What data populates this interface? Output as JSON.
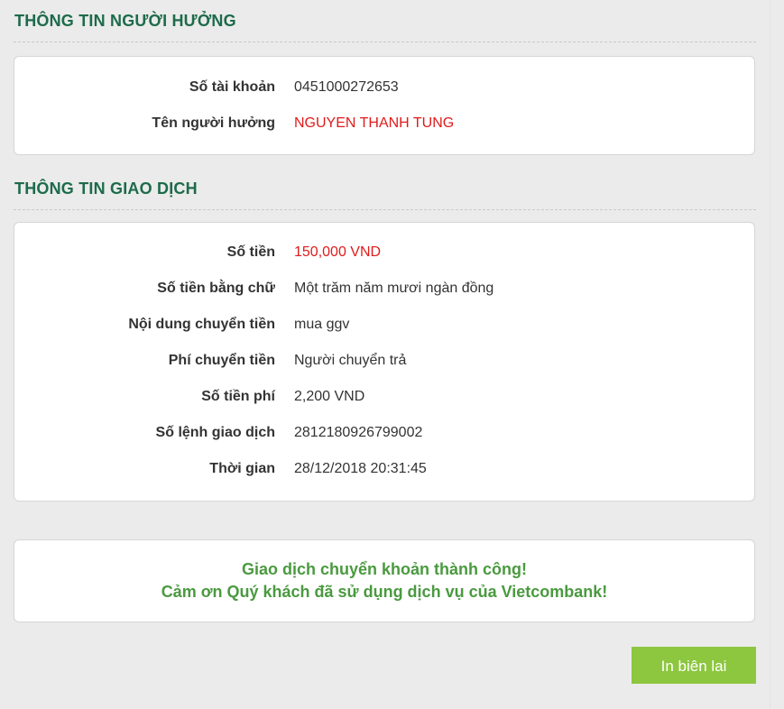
{
  "beneficiary": {
    "title": "THÔNG TIN NGƯỜI HƯỞNG",
    "rows": [
      {
        "label": "Số tài khoản",
        "value": "0451000272653"
      },
      {
        "label": "Tên người hưởng",
        "value": "NGUYEN THANH TUNG"
      }
    ]
  },
  "transaction": {
    "title": "THÔNG TIN GIAO DỊCH",
    "rows": [
      {
        "label": "Số tiền",
        "value": "150,000 VND"
      },
      {
        "label": "Số tiền bằng chữ",
        "value": "Một trăm năm mươi ngàn đồng"
      },
      {
        "label": "Nội dung chuyển tiền",
        "value": "mua ggv"
      },
      {
        "label": "Phí chuyển tiền",
        "value": "Người chuyển trả"
      },
      {
        "label": "Số tiền phí",
        "value": "2,200 VND"
      },
      {
        "label": "Số lệnh giao dịch",
        "value": "2812180926799002"
      },
      {
        "label": "Thời gian",
        "value": "28/12/2018 20:31:45"
      }
    ]
  },
  "success": {
    "line1": "Giao dịch chuyển khoản thành công!",
    "line2": "Cảm ơn Quý khách đã sử dụng dịch vụ của Vietcombank!"
  },
  "actions": {
    "print_label": "In biên lai"
  },
  "colors": {
    "section_title": "#1d6b4a",
    "highlight_value": "#e01b1b",
    "success_text": "#4a9a3f",
    "button_bg": "#8dc63f",
    "page_bg": "#ebebeb"
  }
}
